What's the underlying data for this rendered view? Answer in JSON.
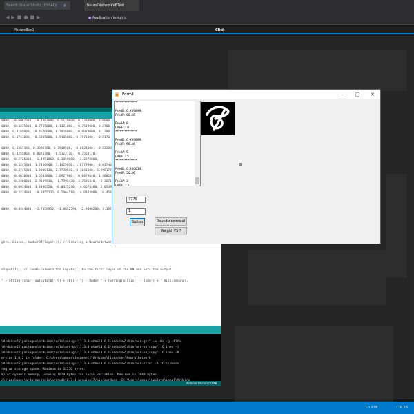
{
  "vs": {
    "search_placeholder": "Search Visual Studio (Ctrl+Q)",
    "project_title": "NeuralNetworkVBTest",
    "insights_label": "Application Insights",
    "nav_left": "PictureBox1",
    "nav_right": "Click",
    "status_ln": "Ln 279",
    "status_col": "Col 15"
  },
  "arduino": {
    "code_lines": [
      "0000, -0.6967000, -0.4363000, 0.5179000, 0.2398000, 0.0000",
      "0000, -0.3235000, 0.7765000, 0.1321000, -0.7519000, 0.2700",
      "0000, 0.8165000, -0.4570000, 0.7426000, -0.6029000, 0.1200",
      "0000, 0.8741000, -0.5305000, 0.9165000, 0.1971000, -0.2170",
      "",
      "0000, 0.3367340, 0.3892760, 0.7948500, -0.0623000, -0.2220940,",
      "0000, 0.4255860, 0.8026380, -0.5122110, -0.7568110,",
      "0000, -0.2726000, -1.4951860, 0.3059660, -3.2672000,",
      "0000, -0.3245000, 1.7466960, 1.1425950, 1.6179900, -0.0374000,",
      "0000, -0.3745000, 1.0000130, 2.7730540, 0.1041100, 5.2981770,",
      "0000, -0.4610000, 1.6533860, 1.6927900, -0.0879640, 1.4802400,",
      "0000, -0.2400000, 2.9109930, -1.7992430, 3.7505340, -2.3671950,",
      "0000, -0.0934000, 3.4490550, -0.0425240, -4.6678380, 2.0539620,",
      "0000, -0.3234000, -0.1955130, 0.2964510, -4.0302990, -0.4547760,",
      "",
      "",
      "0000, -0.4444080, -2.7059950, -1.8652590, -2.9480200, 3.1970",
      "",
      "",
      "",
      "",
      "",
      "ghts, biases, NumberOf(layers));  // Creating a NeuralNetwork",
      "",
      "",
      "",
      "",
      "dInput(I)); // Feeds-Forward the inputs[I] to the first layer of the NN and Gets the output",
      "",
      "\" + String((char)(outputs[0]* 9) + 48)) + \"| - Under \" + (String(millis() - Time)) + \" milliseconds."
    ],
    "console_lines": [
      "",
      "\\Arduino15\\packages\\arduino\\tools\\avr-gcc\\7.3.0-atmel3.6.1-arduino5/bin/avr-gcc\" -w -Os -g -flto",
      "\\Arduino15\\packages\\arduino\\tools\\avr-gcc\\7.3.0-atmel3.6.1-arduino5/bin/avr-objcopy\" -O ihex -j",
      "\\Arduino15\\packages\\arduino\\tools\\avr-gcc\\7.3.0-atmel3.6.1-arduino5/bin/avr-objcopy\" -O ihex -R",
      "ersion 1.0.2 in folder: C:\\Users\\gmous\\Documents\\Arduino\\libraries\\NeuralNetwork",
      "\\Arduino15\\packages\\arduino\\tools\\avr-gcc\\7.3.0-atmel3.6.1-arduino5/bin/avr-size\" -A \"C:\\\\Users",
      "rogram storage space. Maximum is 32256 bytes.",
      "%) of dynamic memory, leaving 1024 bytes for local variables. Maximum is 2048 bytes.",
      "ols\\packages\\arduino\\tools\\avrdude\\6.3.0-arduino17/bin/avrdude -CC:\\Users\\gmous\\AppData\\Local\\Arduino"
    ],
    "board": "Arduino Uno on COM8"
  },
  "form": {
    "title": "Form1",
    "output_lines": [
      "**************",
      "",
      "PredB: 0.939899,",
      "PredR: 56.46",
      "",
      "PredA: 8",
      "LABEL: 8",
      "**************",
      "",
      "PredB: 0.939899,",
      "PredR: 56.46",
      "",
      "PredA: 5",
      "LABEL: 5",
      "**************",
      "",
      "PredB: 0.330614,",
      "PredR: 50.56",
      "",
      "PredA: 3",
      "LABEL: 3",
      "**************"
    ],
    "input1": "7779",
    "input2": "1",
    "button_label": "Button",
    "round_label": "Round decimical",
    "weight_label": "Weight VS ?",
    "digit_value": "8"
  },
  "colors": {
    "vs_accent": "#007acc",
    "arduino_teal": "#17a1a5",
    "arduino_dark": "#006468"
  },
  "icons": [
    "search-icon",
    "bulb-icon",
    "form-icon",
    "minimize-icon",
    "maximize-icon",
    "close-icon"
  ]
}
